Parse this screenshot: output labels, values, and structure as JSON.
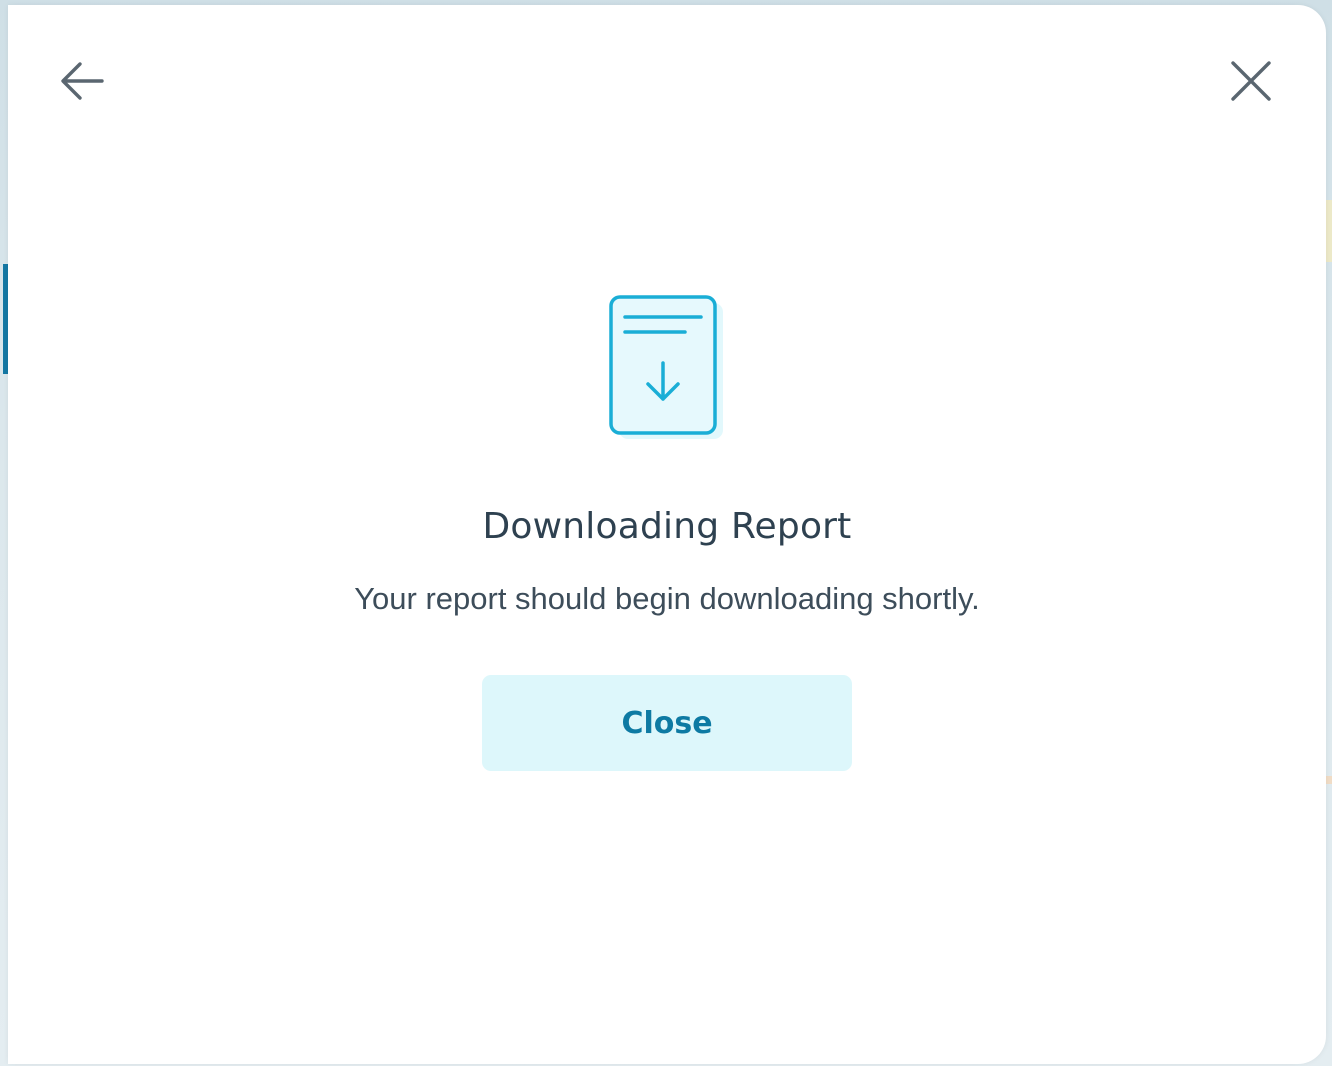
{
  "dialog": {
    "title": "Downloading Report",
    "message": "Your report should begin downloading shortly.",
    "close_label": "Close"
  },
  "icons": {
    "back": "arrow-left-icon",
    "close": "close-x-icon",
    "illustration": "document-download-icon"
  },
  "colors": {
    "accent": "#0d7aa3",
    "icon_stroke": "#1aaed6",
    "button_bg": "#ddf7fb",
    "title_text": "#2e4150",
    "body_text": "#3d4d5a"
  }
}
